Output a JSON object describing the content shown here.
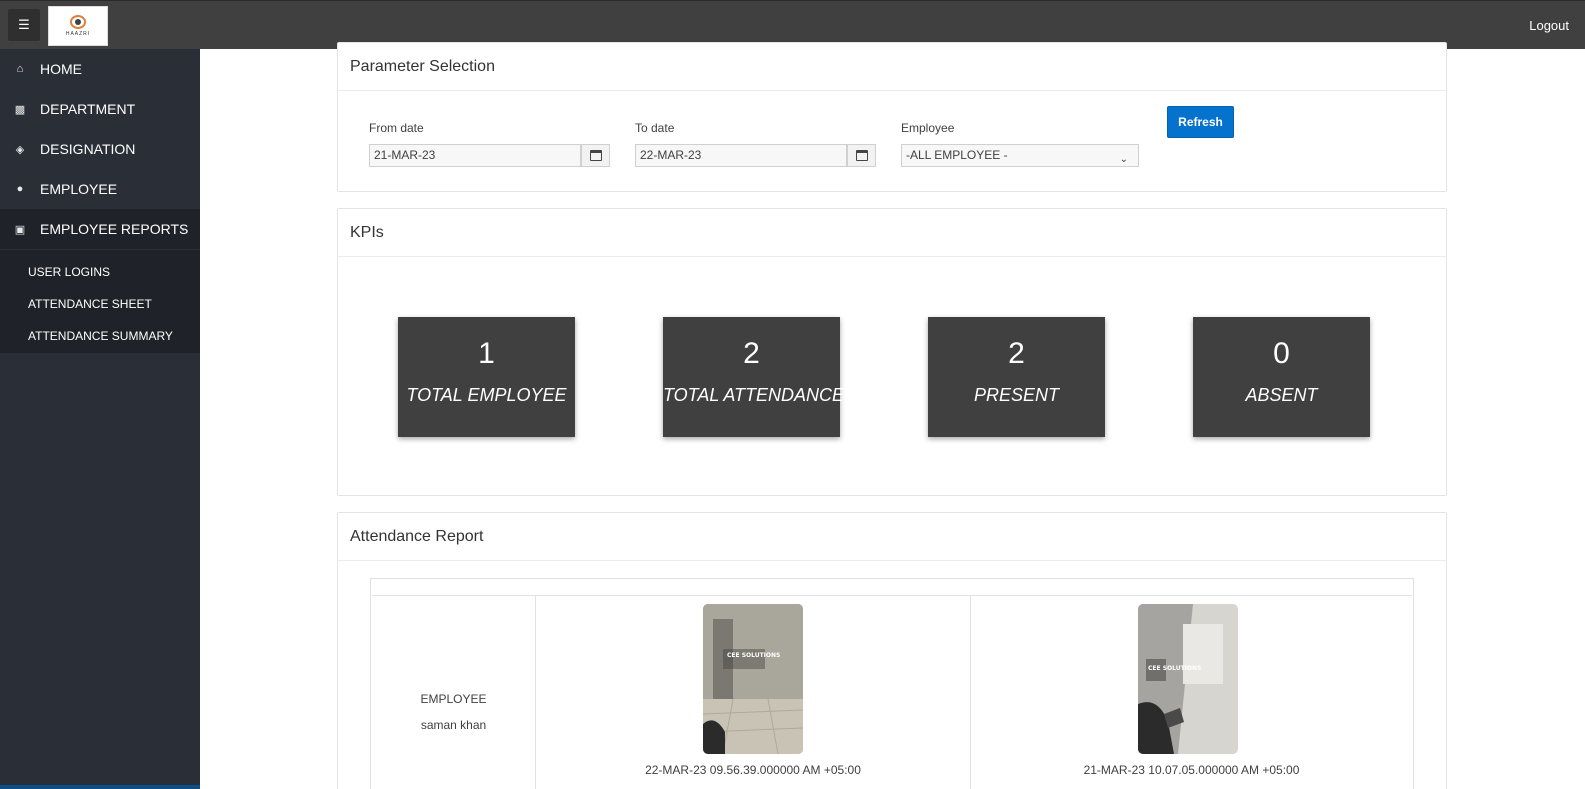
{
  "topbar": {
    "menu_icon": "hamburger-icon",
    "logo_text": "HAAZRI",
    "logout_label": "Logout"
  },
  "sidebar": {
    "items": [
      {
        "label": "HOME",
        "icon": "home-icon"
      },
      {
        "label": "DEPARTMENT",
        "icon": "department-icon"
      },
      {
        "label": "DESIGNATION",
        "icon": "designation-icon"
      },
      {
        "label": "EMPLOYEE",
        "icon": "employee-icon"
      },
      {
        "label": "EMPLOYEE REPORTS",
        "icon": "id-card-icon"
      }
    ],
    "sub_items": [
      "USER LOGINS",
      "ATTENDANCE SHEET",
      "ATTENDANCE SUMMARY"
    ]
  },
  "parameters": {
    "title": "Parameter Selection",
    "from_date_label": "From date",
    "from_date_value": "21-MAR-23",
    "to_date_label": "To date",
    "to_date_value": "22-MAR-23",
    "employee_label": "Employee",
    "employee_value": "-ALL EMPLOYEE -",
    "refresh_label": "Refresh"
  },
  "kpis": {
    "title": "KPIs",
    "cards": [
      {
        "value": "1",
        "label": "TOTAL EMPLOYEE"
      },
      {
        "value": "2",
        "label": "TOTAL ATTENDANCE"
      },
      {
        "value": "2",
        "label": "PRESENT"
      },
      {
        "value": "0",
        "label": "ABSENT"
      }
    ]
  },
  "report": {
    "title": "Attendance Report",
    "employee_heading": "EMPLOYEE",
    "employee_name": "saman khan",
    "entries": [
      {
        "timestamp": "22-MAR-23 09.56.39.000000 AM +05:00",
        "sign_text": "CEE SOLUTIONS"
      },
      {
        "timestamp": "21-MAR-23 10.07.05.000000 AM +05:00",
        "sign_text": "CEE SOLUTIONS"
      }
    ]
  }
}
